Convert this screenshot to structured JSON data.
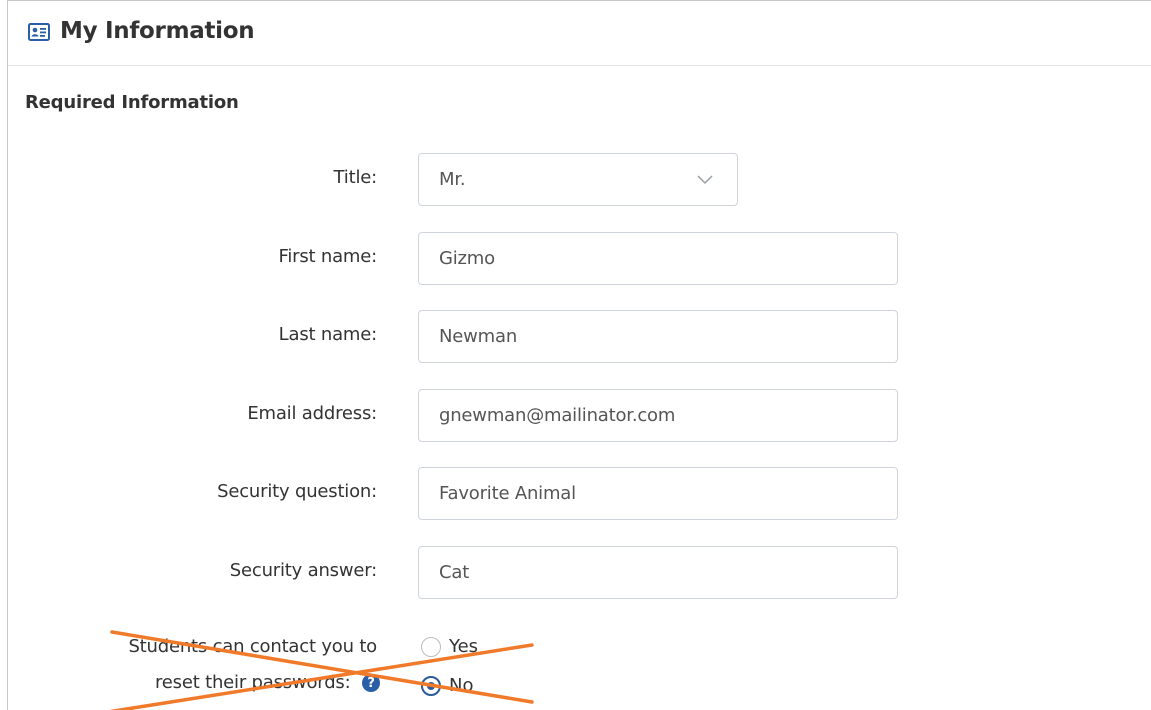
{
  "panel": {
    "title": "My Information",
    "header_icon": "id-card-icon"
  },
  "section": {
    "title": "Required Information"
  },
  "fields": {
    "title": {
      "label": "Title:",
      "value": "Mr."
    },
    "first_name": {
      "label": "First name:",
      "value": "Gizmo"
    },
    "last_name": {
      "label": "Last name:",
      "value": "Newman"
    },
    "email": {
      "label": "Email address:",
      "value": "gnewman@mailinator.com"
    },
    "security_question": {
      "label": "Security question:",
      "value": "Favorite Animal"
    },
    "security_answer": {
      "label": "Security answer:",
      "value": "Cat"
    }
  },
  "contact": {
    "label_line1": "Students can contact you to",
    "label_line2": "reset their passwords:",
    "help_icon": "question-circle-icon",
    "help_glyph": "?",
    "options": [
      {
        "label": "Yes",
        "checked": false
      },
      {
        "label": "No",
        "checked": true
      }
    ]
  },
  "colors": {
    "strike": "#f07a2a",
    "accent": "#2a5a9a",
    "border": "#cfd4da"
  }
}
